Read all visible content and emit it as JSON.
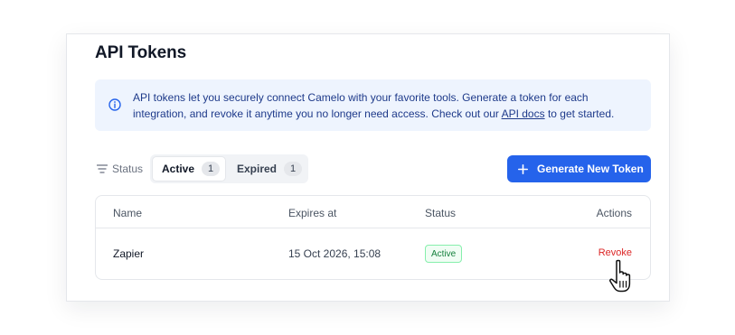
{
  "header": {
    "title": "API Tokens"
  },
  "info": {
    "icon": "info-icon",
    "text_line1": "API tokens let you securely connect Camelo with your favorite tools. Generate a token for each",
    "text_line2_before": "integration, and revoke it anytime you no longer need access. Check out our ",
    "link_text": "API docs",
    "text_line2_after": " to get started."
  },
  "filter": {
    "icon": "filter-lines-icon",
    "label": "Status",
    "tabs": [
      {
        "label": "Active",
        "count": "1",
        "selected": true
      },
      {
        "label": "Expired",
        "count": "1",
        "selected": false
      }
    ]
  },
  "generate_button": {
    "label": "Generate New Token",
    "icon": "plus-icon"
  },
  "table": {
    "columns": [
      "Name",
      "Expires at",
      "Status",
      "Actions"
    ],
    "rows": [
      {
        "name": "Zapier",
        "expires_at": "15 Oct 2026, 15:08",
        "status": "Active",
        "action": "Revoke"
      }
    ]
  },
  "colors": {
    "accent": "#2563eb",
    "info_bg": "#eef4fe",
    "info_text": "#1e3a8a",
    "active_badge_text": "#15803d",
    "active_badge_border": "#86efac",
    "revoke": "#dc2626"
  }
}
